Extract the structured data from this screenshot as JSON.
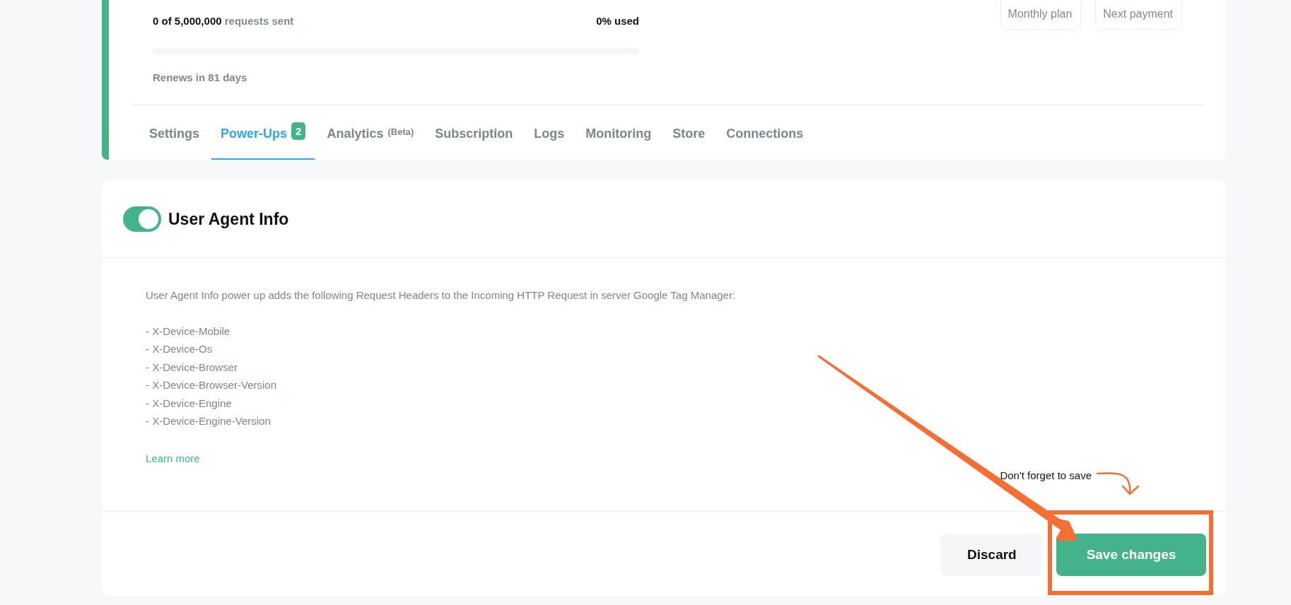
{
  "usage": {
    "sent": "0 of 5,000,000",
    "sent_suffix": "requests sent",
    "percent": "0% used",
    "level": 0,
    "renews": "Renews in 81 days"
  },
  "plan_cards": [
    {
      "subtitle": "Monthly plan"
    },
    {
      "subtitle": "Next payment"
    }
  ],
  "tabs": [
    {
      "label": "Settings",
      "selected": false
    },
    {
      "label": "Power-Ups",
      "selected": true,
      "badge": "2"
    },
    {
      "label": "Analytics",
      "suffix": "(Beta)",
      "selected": false
    },
    {
      "label": "Subscription",
      "selected": false
    },
    {
      "label": "Logs",
      "selected": false
    },
    {
      "label": "Monitoring",
      "selected": false
    },
    {
      "label": "Store",
      "selected": false
    },
    {
      "label": "Connections",
      "selected": false
    }
  ],
  "power_up": {
    "title": "User Agent Info",
    "on": true,
    "description": "User Agent Info power up adds the following Request Headers to the Incoming HTTP Request in server Google Tag Manager:",
    "headers": [
      "- X-Device-Mobile",
      "- X-Device-Os",
      "- X-Device-Browser",
      "- X-Device-Browser-Version",
      "- X-Device-Engine",
      "- X-Device-Engine-Version"
    ],
    "link": "Learn more"
  },
  "annotation": {
    "note": "Don't forget to save"
  },
  "buttons": [
    {
      "label": "Discard",
      "kind": "secondary"
    },
    {
      "label": "Save changes",
      "kind": "primary"
    }
  ]
}
